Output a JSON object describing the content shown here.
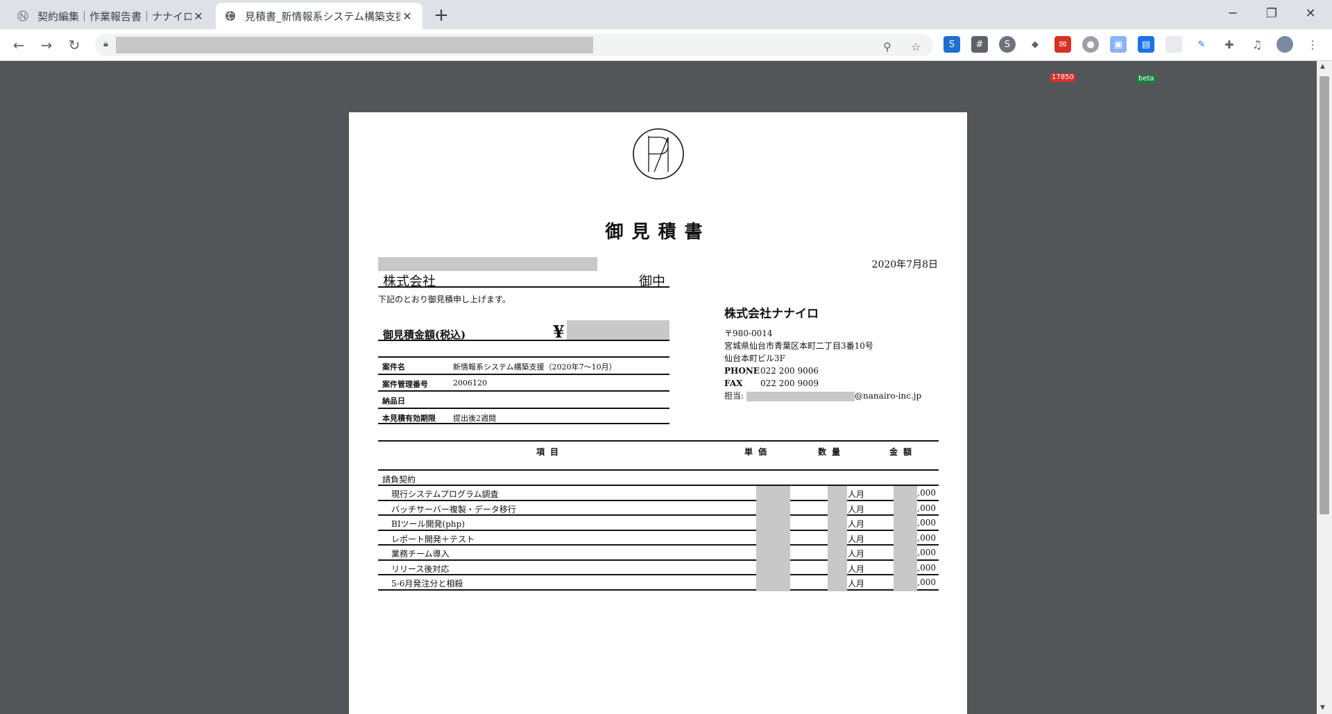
{
  "browser": {
    "tabs": [
      {
        "title": "契約編集｜作業報告書｜ナナイロ",
        "active": false
      },
      {
        "title": "見積書_新情報系システム構築支援",
        "active": true
      }
    ],
    "new_tab_label": "+",
    "extension_badge_count": "17850",
    "extension_beta_label": "beta"
  },
  "document": {
    "title": "御見積書",
    "date": "2020年7月8日",
    "client": {
      "company_suffix": "株式会社",
      "honorific": "御中"
    },
    "intro": "下記のとおり御見積申し上げます。",
    "total": {
      "label": "御見積金額(税込)",
      "currency_symbol": "¥"
    },
    "info": [
      {
        "label": "案件名",
        "value": "新情報系システム構築支援（2020年7～10月）"
      },
      {
        "label": "案件管理番号",
        "value": "2006120"
      },
      {
        "label": "納品日",
        "value": ""
      },
      {
        "label": "本見積有効期限",
        "value": "提出後2週間"
      }
    ],
    "issuer": {
      "name": "株式会社ナナイロ",
      "postal": "〒980-0014",
      "address1": "宮城県仙台市青葉区本町二丁目3番10号",
      "address2": "仙台本町ビル3F",
      "phone_label": "PHONE",
      "phone": "022 200 9006",
      "fax_label": "FAX",
      "fax": "022 200 9009",
      "contact_label": "担当:",
      "contact_email_domain": "nanairo-inc.jp"
    },
    "table": {
      "headers": {
        "item": "項目",
        "unit_price": "単価",
        "quantity": "数量",
        "amount": "金額"
      },
      "section": "請負契約",
      "rows": [
        {
          "name": "現行システムプログラム調査",
          "unit": "人月",
          "amount_tail": ",000"
        },
        {
          "name": "バッチサーバー複製・データ移行",
          "unit": "人月",
          "amount_tail": ",000"
        },
        {
          "name": "BIツール開発(php)",
          "unit": "人月",
          "amount_tail": ",000"
        },
        {
          "name": "レポート開発＋テスト",
          "unit": "人月",
          "amount_tail": ",000"
        },
        {
          "name": "業務チーム導入",
          "unit": "人月",
          "amount_tail": ",000"
        },
        {
          "name": "リリース後対応",
          "unit": "人月",
          "amount_tail": ",000"
        },
        {
          "name": "5-6月発注分と相殺",
          "unit": "人月",
          "amount_tail": ",000"
        }
      ]
    }
  }
}
